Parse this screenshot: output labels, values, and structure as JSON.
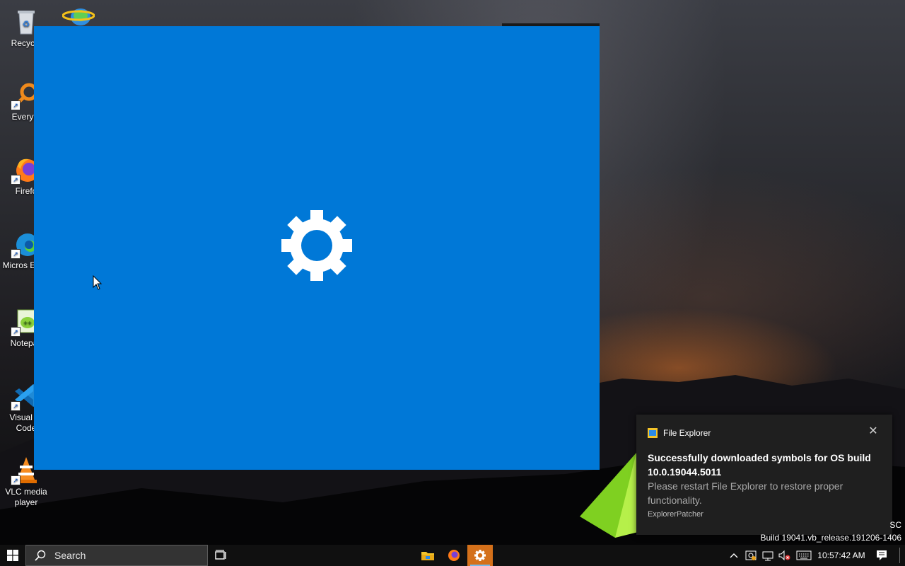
{
  "desktop": {
    "icons": [
      {
        "label": "Recycle",
        "icon": "recycle-bin-icon"
      },
      {
        "label": "Everyth",
        "icon": "everything-search-icon"
      },
      {
        "label": "Firefo",
        "icon": "firefox-icon"
      },
      {
        "label": "Micros Edge",
        "icon": "edge-icon"
      },
      {
        "label": "Notepac",
        "icon": "notepad-plus-plus-icon"
      },
      {
        "label": "Visual St Code",
        "icon": "vscode-icon"
      },
      {
        "label": "VLC media player",
        "icon": "vlc-icon"
      }
    ]
  },
  "splash": {
    "background": "#0078d7",
    "icon": "gear-icon"
  },
  "toast": {
    "app_name": "File Explorer",
    "title": "Successfully downloaded symbols for OS build 10.0.19044.5011",
    "body": "Please restart File Explorer to restore proper functionality.",
    "attribution": "ExplorerPatcher",
    "close_glyph": "✕"
  },
  "watermark": {
    "clipped": "SC",
    "build": "Build 19041.vb_release.191206-1406"
  },
  "taskbar": {
    "search_placeholder": "Search",
    "apps": [
      {
        "name": "file-explorer",
        "active": false
      },
      {
        "name": "firefox",
        "active": false
      },
      {
        "name": "settings",
        "active": true
      }
    ],
    "clock": "10:57:42 AM",
    "accent": "#d4701a"
  }
}
